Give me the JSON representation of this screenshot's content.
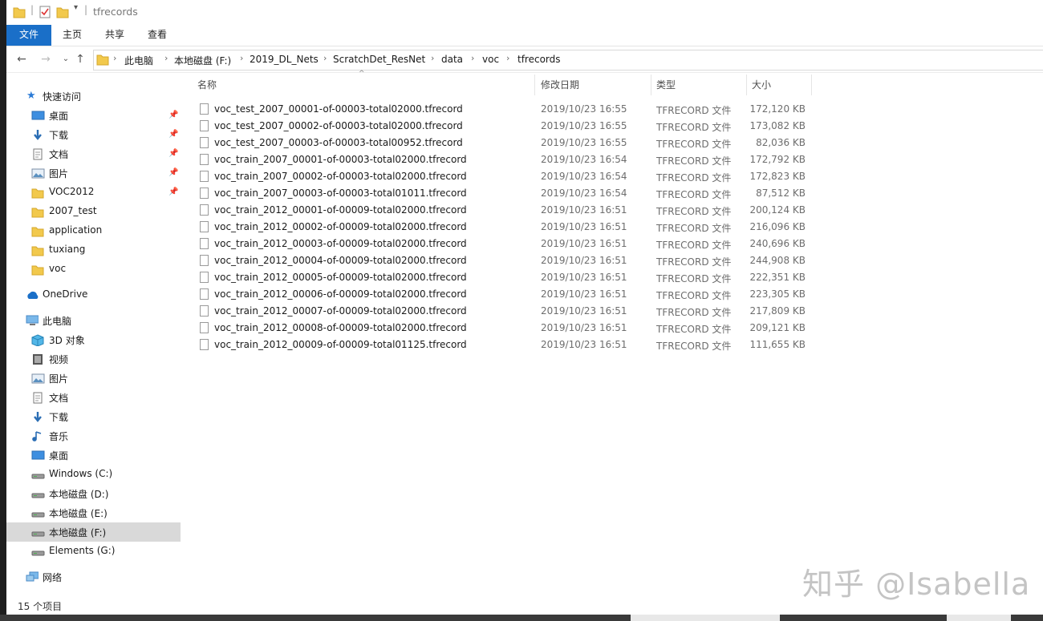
{
  "window": {
    "title": "tfrecords"
  },
  "ribbon": {
    "tabs": [
      {
        "label": "文件",
        "active": true
      },
      {
        "label": "主页",
        "active": false
      },
      {
        "label": "共享",
        "active": false
      },
      {
        "label": "查看",
        "active": false
      }
    ]
  },
  "address": {
    "crumbs": [
      "此电脑",
      "本地磁盘 (F:)",
      "2019_DL_Nets",
      "ScratchDet_ResNet",
      "data",
      "voc",
      "tfrecords"
    ]
  },
  "nav": {
    "quick_access": "快速访问",
    "pinned": [
      {
        "label": "桌面",
        "icon": "desktop-icon",
        "pinned": true
      },
      {
        "label": "下载",
        "icon": "download-icon",
        "pinned": true
      },
      {
        "label": "文档",
        "icon": "document-icon",
        "pinned": true
      },
      {
        "label": "图片",
        "icon": "pictures-icon",
        "pinned": true
      },
      {
        "label": "VOC2012",
        "icon": "folder-icon",
        "pinned": true
      },
      {
        "label": "2007_test",
        "icon": "folder-icon",
        "pinned": false
      },
      {
        "label": "application",
        "icon": "folder-icon",
        "pinned": false
      },
      {
        "label": "tuxiang",
        "icon": "folder-icon",
        "pinned": false
      },
      {
        "label": "voc",
        "icon": "folder-icon",
        "pinned": false
      }
    ],
    "onedrive": "OneDrive",
    "this_pc": "此电脑",
    "pc_items": [
      {
        "label": "3D 对象",
        "icon": "3d-objects-icon"
      },
      {
        "label": "视频",
        "icon": "video-icon"
      },
      {
        "label": "图片",
        "icon": "pictures-icon"
      },
      {
        "label": "文档",
        "icon": "document-icon"
      },
      {
        "label": "下载",
        "icon": "download-icon"
      },
      {
        "label": "音乐",
        "icon": "music-icon"
      },
      {
        "label": "桌面",
        "icon": "desktop-icon"
      },
      {
        "label": "Windows (C:)",
        "icon": "drive-icon"
      },
      {
        "label": "本地磁盘 (D:)",
        "icon": "drive-icon"
      },
      {
        "label": "本地磁盘 (E:)",
        "icon": "drive-icon"
      },
      {
        "label": "本地磁盘 (F:)",
        "icon": "drive-icon",
        "selected": true
      },
      {
        "label": "Elements (G:)",
        "icon": "drive-icon"
      }
    ],
    "network": "网络"
  },
  "columns": {
    "name": "名称",
    "date": "修改日期",
    "type": "类型",
    "size": "大小"
  },
  "files": [
    {
      "name": "voc_test_2007_00001-of-00003-total02000.tfrecord",
      "date": "2019/10/23 16:55",
      "type": "TFRECORD 文件",
      "size": "172,120 KB"
    },
    {
      "name": "voc_test_2007_00002-of-00003-total02000.tfrecord",
      "date": "2019/10/23 16:55",
      "type": "TFRECORD 文件",
      "size": "173,082 KB"
    },
    {
      "name": "voc_test_2007_00003-of-00003-total00952.tfrecord",
      "date": "2019/10/23 16:55",
      "type": "TFRECORD 文件",
      "size": "82,036 KB"
    },
    {
      "name": "voc_train_2007_00001-of-00003-total02000.tfrecord",
      "date": "2019/10/23 16:54",
      "type": "TFRECORD 文件",
      "size": "172,792 KB"
    },
    {
      "name": "voc_train_2007_00002-of-00003-total02000.tfrecord",
      "date": "2019/10/23 16:54",
      "type": "TFRECORD 文件",
      "size": "172,823 KB"
    },
    {
      "name": "voc_train_2007_00003-of-00003-total01011.tfrecord",
      "date": "2019/10/23 16:54",
      "type": "TFRECORD 文件",
      "size": "87,512 KB"
    },
    {
      "name": "voc_train_2012_00001-of-00009-total02000.tfrecord",
      "date": "2019/10/23 16:51",
      "type": "TFRECORD 文件",
      "size": "200,124 KB"
    },
    {
      "name": "voc_train_2012_00002-of-00009-total02000.tfrecord",
      "date": "2019/10/23 16:51",
      "type": "TFRECORD 文件",
      "size": "216,096 KB"
    },
    {
      "name": "voc_train_2012_00003-of-00009-total02000.tfrecord",
      "date": "2019/10/23 16:51",
      "type": "TFRECORD 文件",
      "size": "240,696 KB"
    },
    {
      "name": "voc_train_2012_00004-of-00009-total02000.tfrecord",
      "date": "2019/10/23 16:51",
      "type": "TFRECORD 文件",
      "size": "244,908 KB"
    },
    {
      "name": "voc_train_2012_00005-of-00009-total02000.tfrecord",
      "date": "2019/10/23 16:51",
      "type": "TFRECORD 文件",
      "size": "222,351 KB"
    },
    {
      "name": "voc_train_2012_00006-of-00009-total02000.tfrecord",
      "date": "2019/10/23 16:51",
      "type": "TFRECORD 文件",
      "size": "223,305 KB"
    },
    {
      "name": "voc_train_2012_00007-of-00009-total02000.tfrecord",
      "date": "2019/10/23 16:51",
      "type": "TFRECORD 文件",
      "size": "217,809 KB"
    },
    {
      "name": "voc_train_2012_00008-of-00009-total02000.tfrecord",
      "date": "2019/10/23 16:51",
      "type": "TFRECORD 文件",
      "size": "209,121 KB"
    },
    {
      "name": "voc_train_2012_00009-of-00009-total01125.tfrecord",
      "date": "2019/10/23 16:51",
      "type": "TFRECORD 文件",
      "size": "111,655 KB"
    }
  ],
  "status": {
    "item_count": "15 个项目"
  },
  "watermark": "知乎 @Isabella",
  "colors": {
    "accent": "#1a6fc8",
    "selected_bg": "#d9d9d9",
    "folder": "#f2c94c"
  }
}
